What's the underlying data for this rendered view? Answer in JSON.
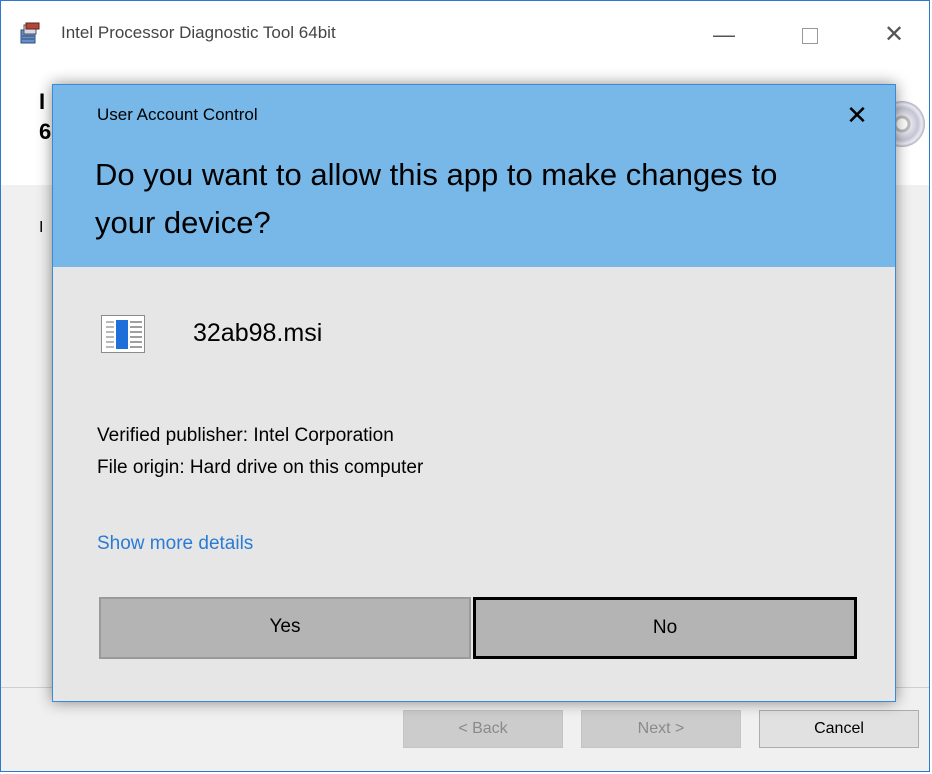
{
  "installer": {
    "title": "Intel Processor Diagnostic Tool 64bit",
    "header_line1": "I",
    "header_line2": "6",
    "body_text": "I",
    "buttons": {
      "back": "< Back",
      "next": "Next >",
      "cancel": "Cancel"
    },
    "window_controls": {
      "minimize": "—",
      "close": "✕"
    }
  },
  "uac": {
    "label": "User Account Control",
    "close": "✕",
    "question": "Do you want to allow this app to make changes to your device?",
    "app_name": "32ab98.msi",
    "publisher": "Verified publisher: Intel Corporation",
    "origin": "File origin: Hard drive on this computer",
    "details_link": "Show more details",
    "yes_label": "Yes",
    "no_label": "No",
    "header_color": "#77b8e9",
    "link_color": "#2a7bd4"
  }
}
